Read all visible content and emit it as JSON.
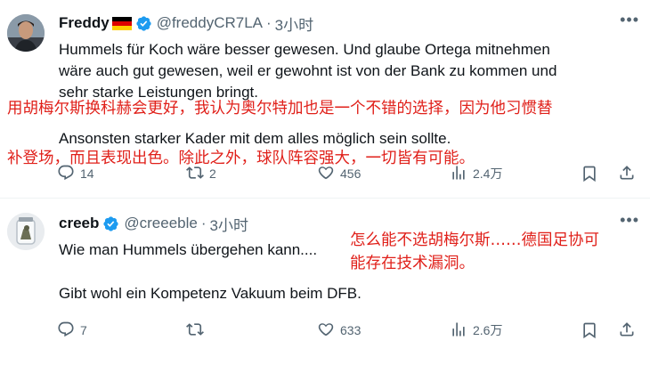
{
  "tweets": [
    {
      "name": "Freddy",
      "handle": "@freddyCR7LA",
      "dot": "·",
      "time": "3小时",
      "lines": [
        "Hummels für Koch wäre besser gewesen. Und glaube Ortega mitnehmen",
        "wäre auch gut gewesen, weil er gewohnt ist von der Bank zu kommen und",
        "sehr starke Leistungen bringt.",
        "Ansonsten starker Kader mit dem alles möglich sein sollte."
      ],
      "annotations": [
        "用胡梅尔斯换科赫会更好，我认为奥尔特加也是一个不错的选择，因为他习惯替",
        "补登场，而且表现出色。除此之外，球队阵容强大，一切皆有可能。"
      ],
      "stats": {
        "replies": "14",
        "reposts": "2",
        "likes": "456",
        "views": "2.4万"
      }
    },
    {
      "name": "creeb",
      "handle": "@creeeble",
      "dot": "·",
      "time": "3小时",
      "lines": [
        "Wie man Hummels übergehen kann....",
        "Gibt wohl ein Kompetenz Vakuum beim DFB."
      ],
      "annotations": [
        "怎么能不选胡梅尔斯……德国足协可",
        "能存在技术漏洞。"
      ],
      "stats": {
        "replies": "7",
        "reposts": "",
        "likes": "633",
        "views": "2.6万"
      }
    }
  ],
  "icons": {
    "verified": "verified-badge-icon",
    "more": "more-icon",
    "reply": "reply-icon",
    "repost": "repost-icon",
    "like": "like-icon",
    "views": "views-icon",
    "bookmark": "bookmark-icon",
    "share": "share-icon"
  },
  "colors": {
    "annotation": "#e0201a",
    "verified": "#1d9bf0",
    "muted": "#536471"
  }
}
